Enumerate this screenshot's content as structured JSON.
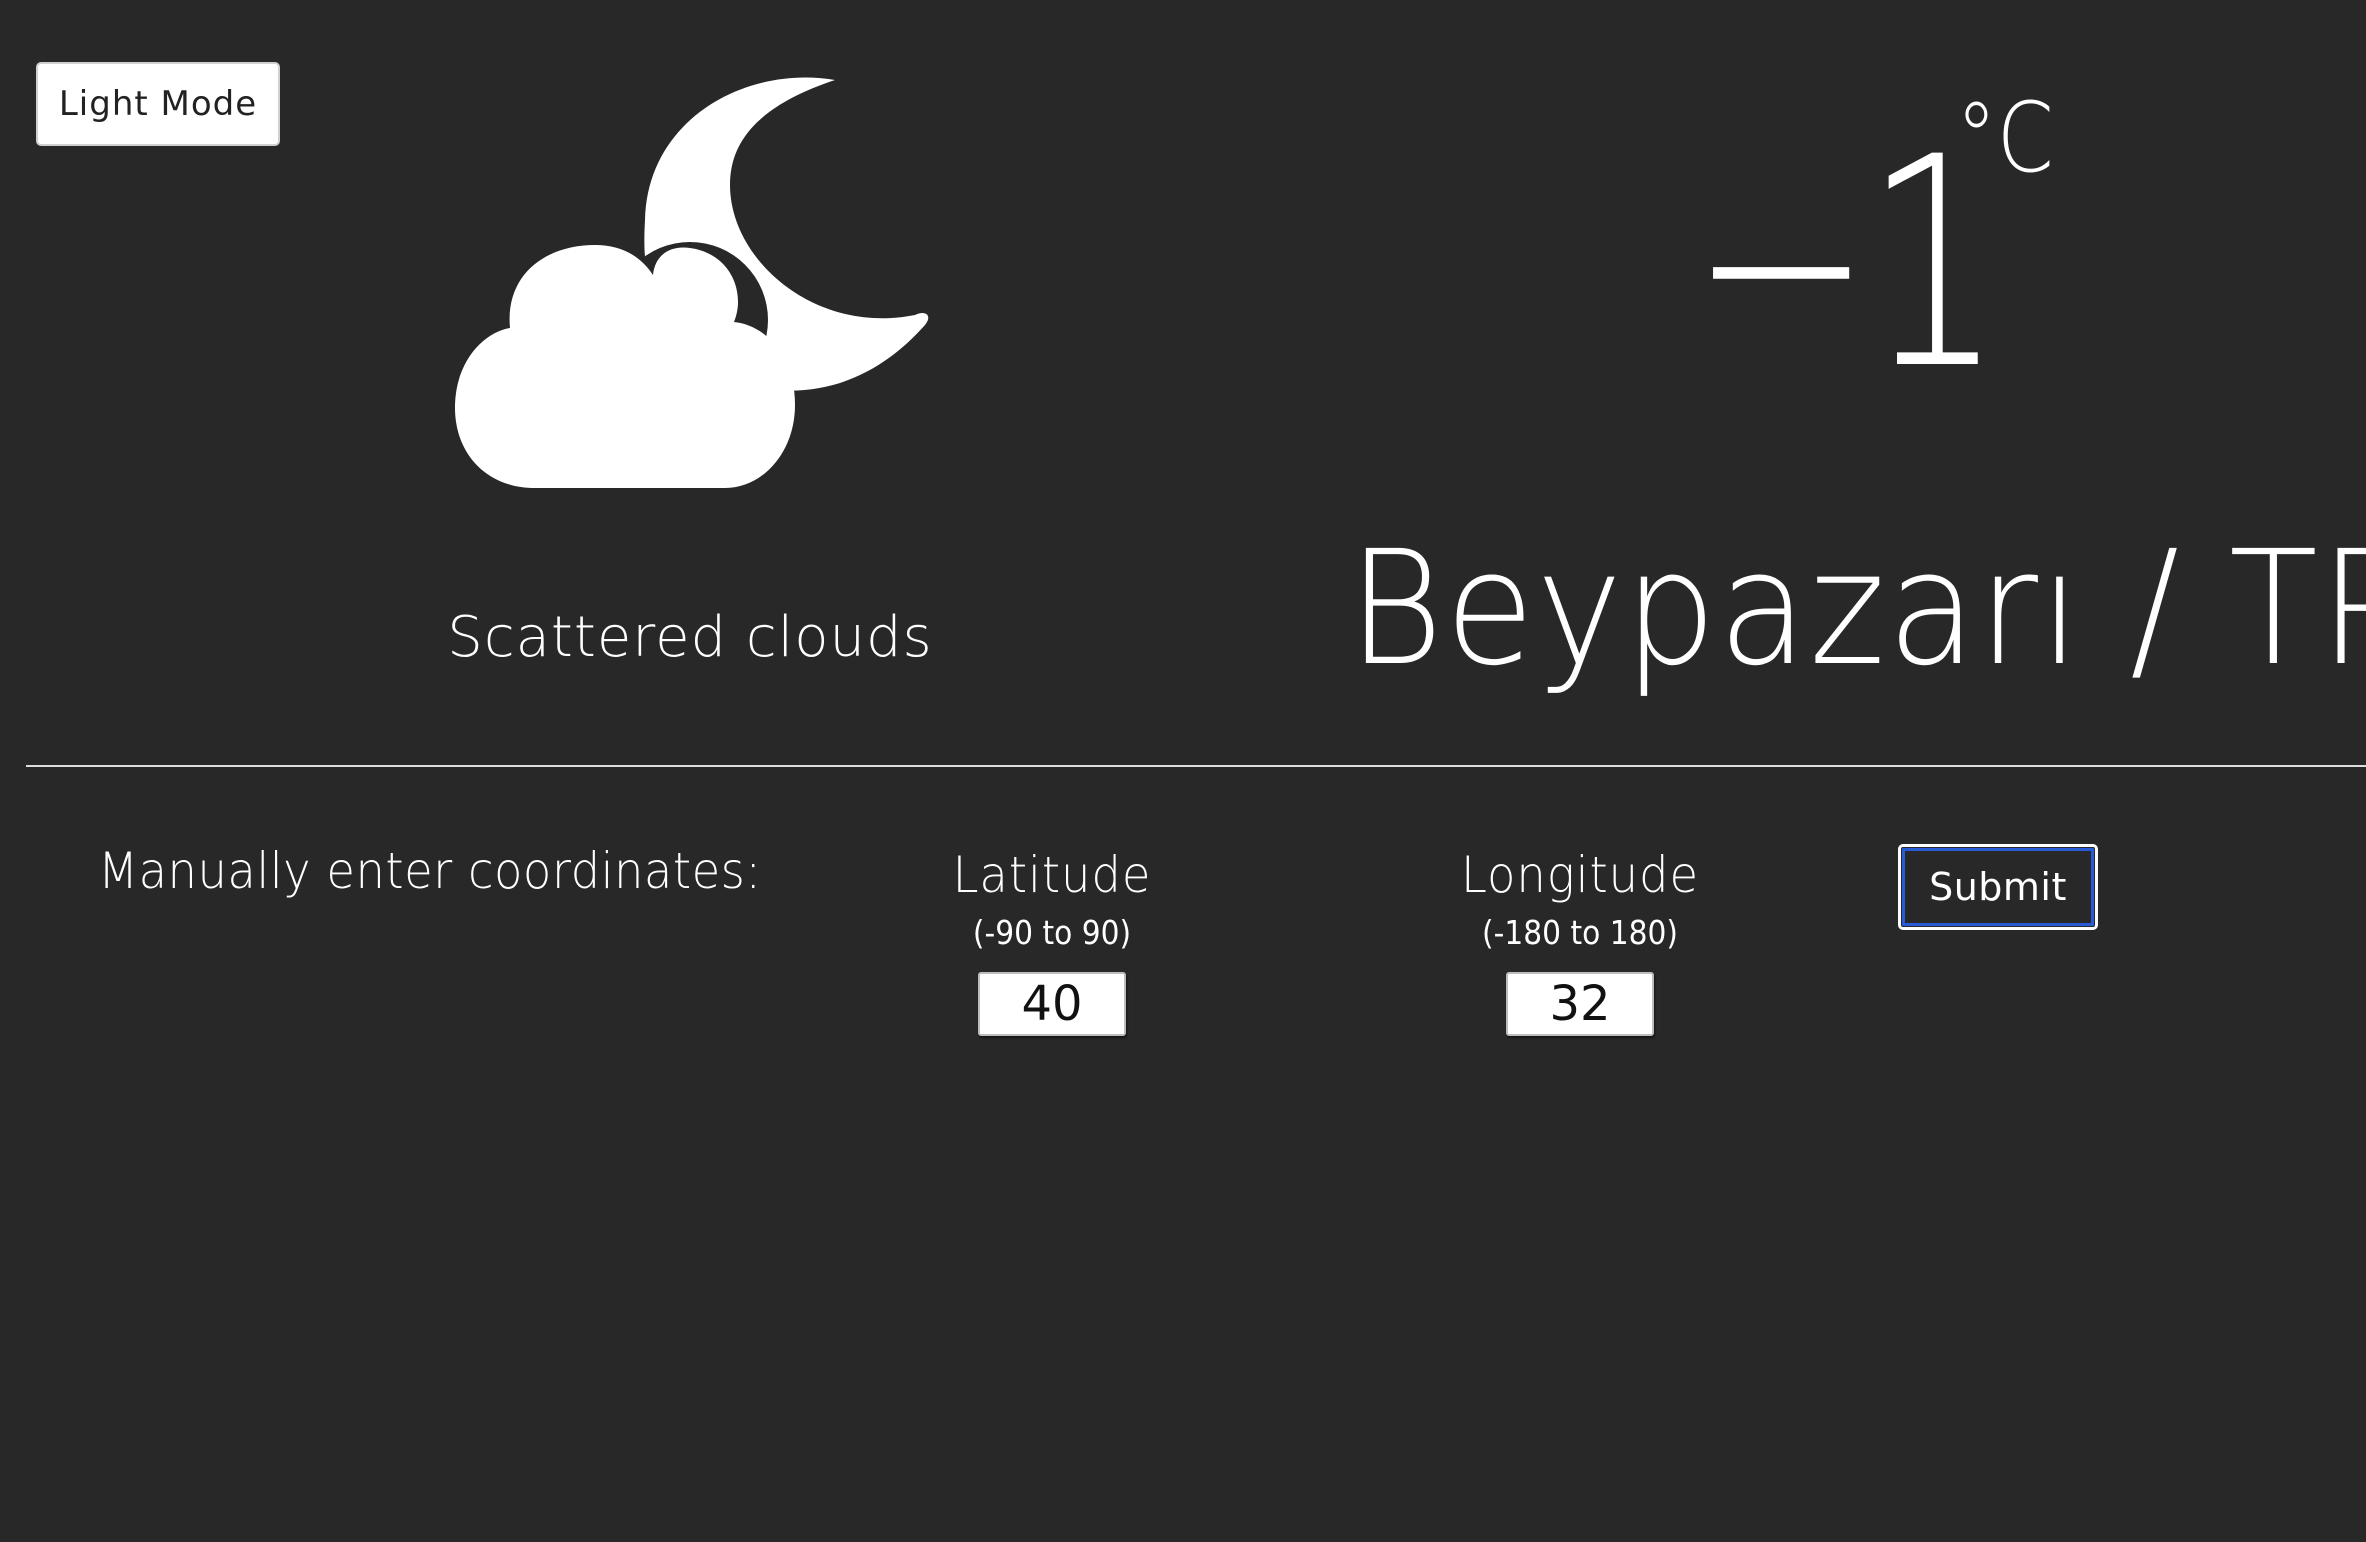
{
  "theme_toggle": {
    "label": "Light Mode"
  },
  "weather": {
    "icon": "night-partly-cloudy-icon",
    "description": "Scattered clouds",
    "temperature": "−1",
    "unit": "°C",
    "location": "Beypazarı / TR"
  },
  "manual_entry": {
    "label": "Manually enter coordinates:",
    "latitude": {
      "title": "Latitude",
      "range": "(-90 to 90)",
      "value": "40"
    },
    "longitude": {
      "title": "Longitude",
      "range": "(-180 to 180)",
      "value": "32"
    },
    "submit_label": "Submit"
  },
  "colors": {
    "background": "#282828",
    "foreground": "#ffffff",
    "focus_ring": "#2a5bd7"
  }
}
